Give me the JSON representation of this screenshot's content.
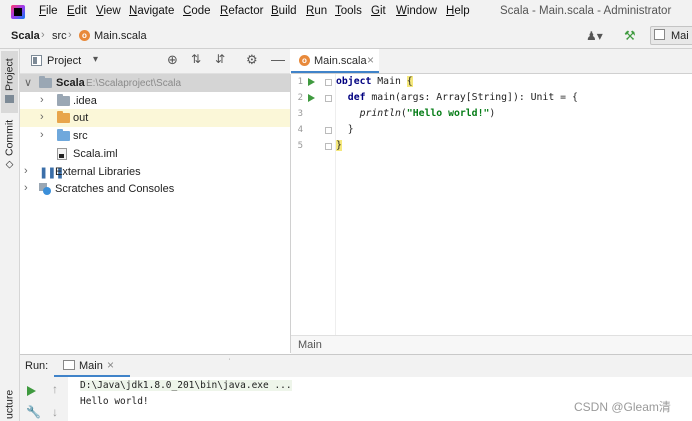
{
  "menubar": {
    "items": [
      {
        "label": "File",
        "mnemonic": "F",
        "rest": "ile"
      },
      {
        "label": "Edit",
        "mnemonic": "E",
        "rest": "dit"
      },
      {
        "label": "View",
        "mnemonic": "V",
        "rest": "iew"
      },
      {
        "label": "Navigate",
        "mnemonic": "N",
        "rest": "avigate"
      },
      {
        "label": "Code",
        "mnemonic": "C",
        "rest": "ode"
      },
      {
        "label": "Refactor",
        "mnemonic": "R",
        "rest": "efactor"
      },
      {
        "label": "Build",
        "mnemonic": "B",
        "rest": "uild"
      },
      {
        "label": "Run",
        "mnemonic": "R",
        "rest": "un"
      },
      {
        "label": "Tools",
        "mnemonic": "T",
        "rest": "ools"
      },
      {
        "label": "Git",
        "mnemonic": "G",
        "rest": "it"
      },
      {
        "label": "Window",
        "mnemonic": "W",
        "rest": "indow"
      },
      {
        "label": "Help",
        "mnemonic": "H",
        "rest": "elp"
      }
    ],
    "window_title": "Scala - Main.scala - Administrator"
  },
  "navbar": {
    "crumb_project": "Scala",
    "crumb_folder": "src",
    "crumb_file": "Main.scala",
    "right_button": "Mai"
  },
  "left_strip": {
    "project_tab": "Project",
    "commit_tab": "Commit",
    "structure_tab": "ucture"
  },
  "project_panel": {
    "header_label": "Project",
    "tree": [
      {
        "label": "Scala",
        "path": "E:\\Scalaproject\\Scala"
      },
      {
        "label": ".idea"
      },
      {
        "label": "out"
      },
      {
        "label": "src"
      },
      {
        "label": "Scala.iml"
      },
      {
        "label": "External Libraries"
      },
      {
        "label": "Scratches and Consoles"
      }
    ]
  },
  "editor": {
    "tab_label": "Main.scala",
    "line_numbers": [
      "1",
      "2",
      "3",
      "4",
      "5"
    ],
    "lines": [
      {
        "kw": "object",
        "rest": " Main ",
        "brace": "{"
      },
      {
        "pre": "  ",
        "kw": "def",
        "rest": " main(args: Array[String]): Unit = {"
      },
      {
        "pre": "    ",
        "fn": "println",
        "open": "(",
        "str": "\"Hello world!\"",
        "close": ")"
      },
      {
        "text": "  }"
      },
      {
        "brace": "}"
      }
    ],
    "breadcrumb": "Main"
  },
  "run_panel": {
    "label": "Run:",
    "tab_label": "Main",
    "command": "D:\\Java\\jdk1.8.0_201\\bin\\java.exe ...",
    "output": "Hello world!"
  },
  "watermark": "CSDN @Gleam清",
  "colors": {
    "accent": "#4083c9",
    "run_green": "#3f9a3f",
    "scala_orange": "#e8893a",
    "folder_gray": "#9aa7b4",
    "folder_orange": "#e8a54b",
    "folder_blue": "#6fa8dc"
  }
}
